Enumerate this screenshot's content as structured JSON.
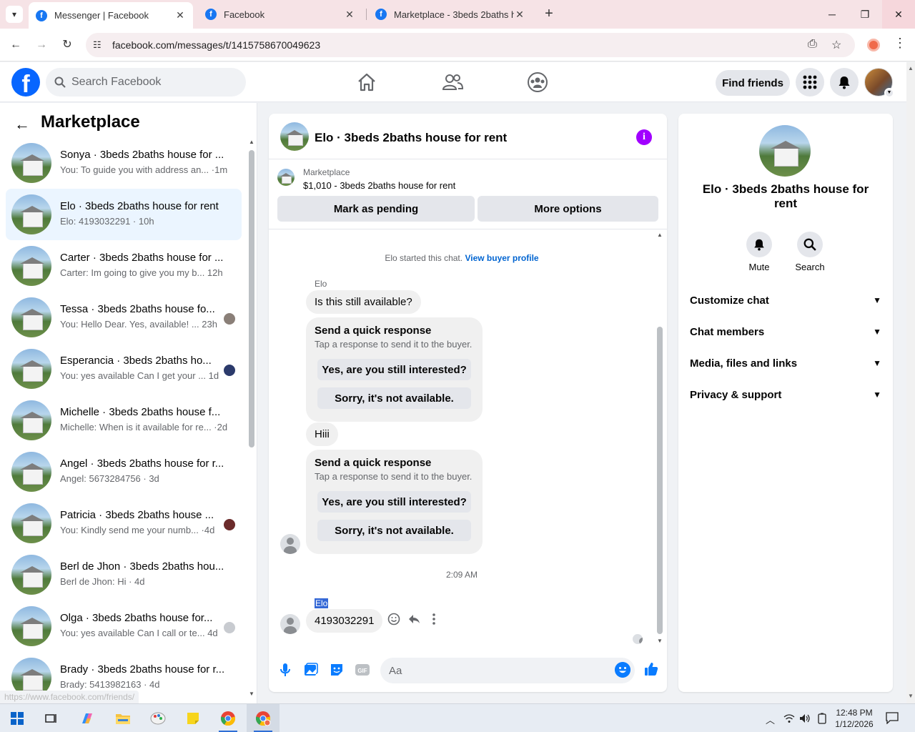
{
  "browser": {
    "tabs": [
      {
        "title": "Messenger | Facebook",
        "active": true
      },
      {
        "title": "Facebook",
        "active": false
      },
      {
        "title": "Marketplace - 3beds 2baths ho",
        "active": false
      }
    ],
    "url": "facebook.com/messages/t/1415758670049623",
    "status_url": "https://www.facebook.com/friends/"
  },
  "header": {
    "logo": "f",
    "search_placeholder": "Search Facebook",
    "find_friends": "Find friends",
    "nav_icons": [
      "home-icon",
      "friends-icon",
      "groups-icon"
    ]
  },
  "left": {
    "title": "Marketplace",
    "conversations": [
      {
        "name": "Sonya · 3beds 2baths house for ...",
        "snippet": "You: To guide you with address an... ·1m",
        "mini": ""
      },
      {
        "name": "Elo · 3beds 2baths house for rent",
        "snippet": "Elo: 4193032291 · 10h",
        "mini": "",
        "selected": true
      },
      {
        "name": "Carter · 3beds 2baths house for ...",
        "snippet": "Carter: Im going to give you my b... 12h",
        "mini": ""
      },
      {
        "name": "Tessa · 3beds 2baths house fo...",
        "snippet": "You: Hello Dear. Yes, available! ... 23h",
        "mini": "#8a7f78"
      },
      {
        "name": "Esperancia · 3beds 2baths ho...",
        "snippet": "You: yes available Can I get your ... 1d",
        "mini": "#2b3a6b"
      },
      {
        "name": "Michelle · 3beds 2baths house f...",
        "snippet": "Michelle: When is it available for re... ·2d",
        "mini": ""
      },
      {
        "name": "Angel · 3beds 2baths house for r...",
        "snippet": "Angel: 5673284756 · 3d",
        "mini": ""
      },
      {
        "name": "Patricia · 3beds 2baths house ...",
        "snippet": "You: Kindly send me your numb... ·4d",
        "mini": "#6b2b2b"
      },
      {
        "name": "Berl de Jhon · 3beds 2baths hou...",
        "snippet": "Berl de Jhon: Hi · 4d",
        "mini": ""
      },
      {
        "name": "Olga · 3beds 2baths house for...",
        "snippet": "You: yes available Can I call or te... 4d",
        "mini": "#c8cbd0"
      },
      {
        "name": "Brady · 3beds 2baths house for r...",
        "snippet": "Brady: 5413982163 · 4d",
        "mini": ""
      }
    ]
  },
  "chat": {
    "title": "Elo · 3beds 2baths house for rent",
    "listing_source": "Marketplace",
    "listing_price": "$1,010 - 3beds 2baths house for rent",
    "mark_pending": "Mark as pending",
    "more_options": "More options",
    "started_text": "Elo started this chat.",
    "view_profile": "View buyer profile",
    "sender": "Elo",
    "msg1": "Is this still available?",
    "qr_title": "Send a quick response",
    "qr_sub": "Tap a response to send it to the buyer.",
    "qr_opt1": "Yes, are you still interested?",
    "qr_opt2": "Sorry, it's not available.",
    "msg2": "Hiii",
    "timestamp": "2:09 AM",
    "sender2": "Elo",
    "msg3": "4193032291",
    "composer_placeholder": "Aa"
  },
  "right": {
    "name": "Elo · 3beds 2baths house for rent",
    "mute": "Mute",
    "search": "Search",
    "sections": [
      "Customize chat",
      "Chat members",
      "Media, files and links",
      "Privacy & support"
    ]
  },
  "taskbar": {
    "time": "12:48 PM",
    "date": "1/12/2026"
  },
  "colors": {
    "fb_blue": "#0866ff",
    "messenger_blue": "#0a7cff",
    "info_purple": "#a100ff",
    "selected_row": "#ebf5ff"
  }
}
